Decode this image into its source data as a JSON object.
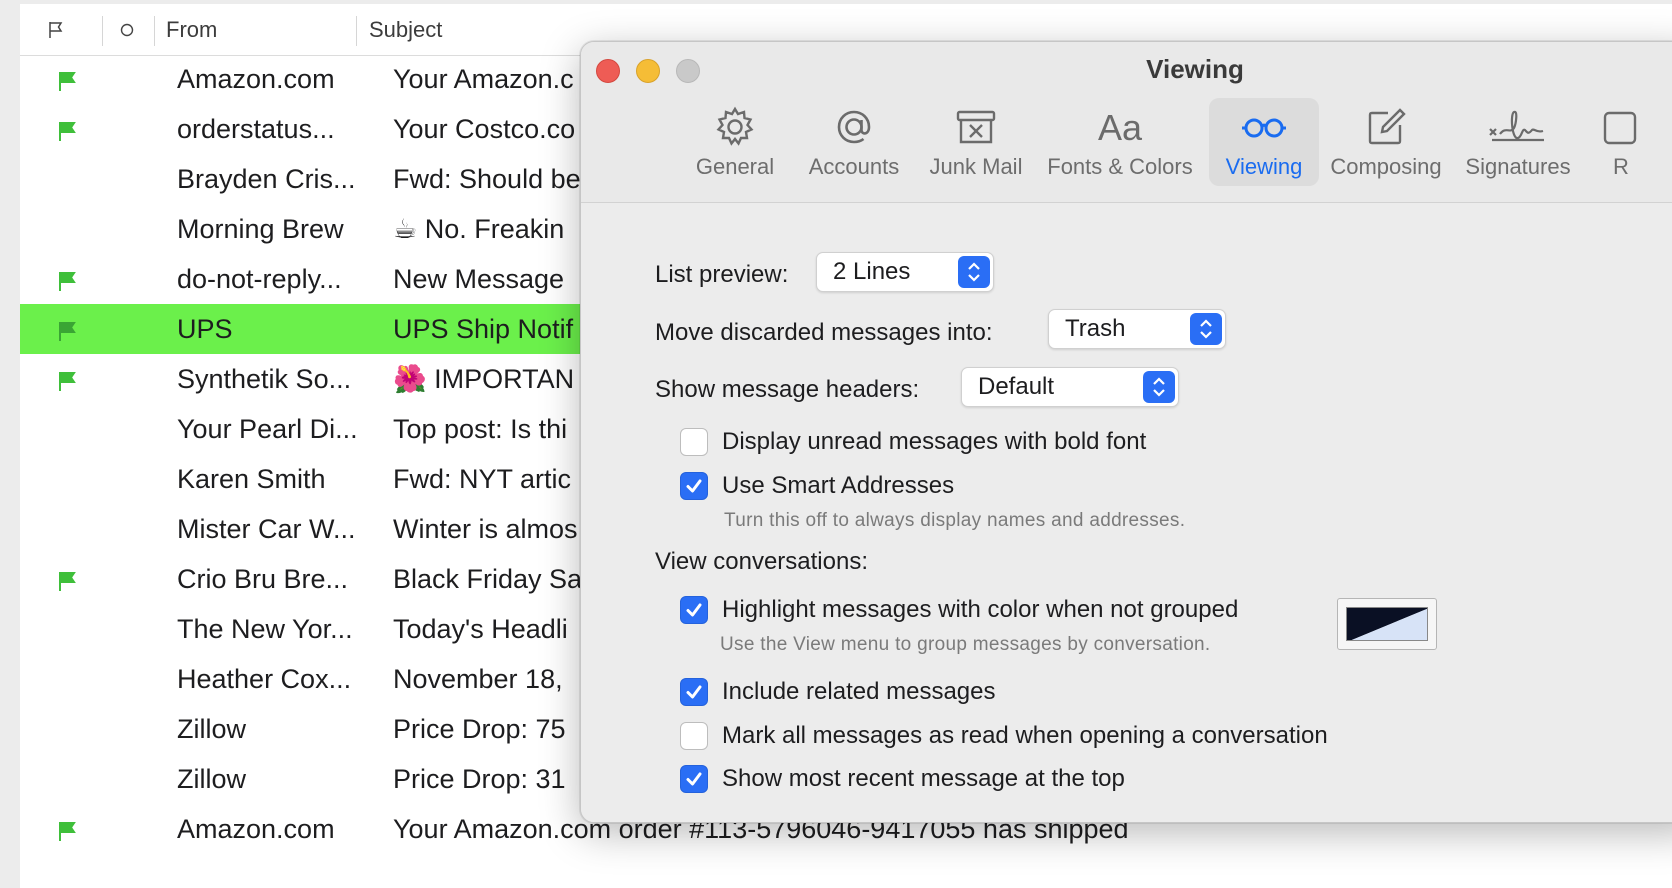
{
  "mail_list": {
    "columns": {
      "flag_icon": "flag-icon",
      "status_icon": "circle-icon",
      "from": "From",
      "subject": "Subject"
    },
    "rows": [
      {
        "from": "Amazon.com",
        "subject": "Your Amazon.c",
        "flagged": true,
        "selected": false
      },
      {
        "from": "orderstatus...",
        "subject": "Your Costco.co",
        "flagged": true,
        "selected": false
      },
      {
        "from": "Brayden Cris...",
        "subject": "Fwd: Should be",
        "flagged": false,
        "selected": false
      },
      {
        "from": "Morning Brew",
        "subject": "☕ No. Freakin",
        "flagged": false,
        "selected": false
      },
      {
        "from": "do-not-reply...",
        "subject": "New Message",
        "flagged": true,
        "selected": false
      },
      {
        "from": "UPS",
        "subject": "UPS Ship Notif",
        "flagged": true,
        "selected": true
      },
      {
        "from": "Synthetik So...",
        "subject": "🌺 IMPORTAN",
        "flagged": true,
        "selected": false
      },
      {
        "from": "Your Pearl Di...",
        "subject": "Top post: Is thi",
        "flagged": false,
        "selected": false
      },
      {
        "from": "Karen Smith",
        "subject": "Fwd: NYT artic",
        "flagged": false,
        "selected": false
      },
      {
        "from": "Mister Car W...",
        "subject": "Winter is almos",
        "flagged": false,
        "selected": false
      },
      {
        "from": "Crio Bru Bre...",
        "subject": "Black Friday Sa",
        "flagged": true,
        "selected": false
      },
      {
        "from": "The New Yor...",
        "subject": "Today's Headli",
        "flagged": false,
        "selected": false
      },
      {
        "from": "Heather Cox...",
        "subject": "November 18,",
        "flagged": false,
        "selected": false
      },
      {
        "from": "Zillow",
        "subject": "Price Drop: 75",
        "flagged": false,
        "selected": false
      },
      {
        "from": "Zillow",
        "subject": "Price Drop: 31",
        "flagged": false,
        "selected": false
      },
      {
        "from": "Amazon.com",
        "subject": "Your Amazon.com order #113-5796046-9417055 has shipped",
        "flagged": true,
        "selected": false
      }
    ],
    "flag_color": "#3fbf3a",
    "selected_color": "#6bf04b"
  },
  "prefs_window": {
    "title": "Viewing",
    "tabs": [
      {
        "label": "General",
        "icon": "gear-icon",
        "active": false
      },
      {
        "label": "Accounts",
        "icon": "at-sign-icon",
        "active": false
      },
      {
        "label": "Junk Mail",
        "icon": "junk-box-icon",
        "active": false
      },
      {
        "label": "Fonts & Colors",
        "icon": "font-aa-icon",
        "active": false
      },
      {
        "label": "Viewing",
        "icon": "glasses-icon",
        "active": true
      },
      {
        "label": "Composing",
        "icon": "compose-icon",
        "active": false
      },
      {
        "label": "Signatures",
        "icon": "signature-icon",
        "active": false
      },
      {
        "label": "R",
        "icon": "rules-icon",
        "active": false
      }
    ],
    "list_preview": {
      "label": "List preview:",
      "value": "2 Lines"
    },
    "move_discarded": {
      "label": "Move discarded messages into:",
      "value": "Trash"
    },
    "show_headers": {
      "label": "Show message headers:",
      "value": "Default"
    },
    "bold_unread": {
      "label": "Display unread messages with bold font",
      "checked": false
    },
    "smart_addresses": {
      "label": "Use Smart Addresses",
      "checked": true,
      "hint": "Turn this off to always display names and addresses."
    },
    "view_conversations": {
      "label": "View conversations:"
    },
    "highlight_color": {
      "label": "Highlight messages with color when not grouped",
      "checked": true,
      "hint": "Use the View menu to group messages by conversation.",
      "swatch_dark": "#0a1024",
      "swatch_light": "#d7e3f7"
    },
    "include_related": {
      "label": "Include related messages",
      "checked": true
    },
    "mark_all_read": {
      "label": "Mark all messages as read when opening a conversation",
      "checked": false
    },
    "recent_top": {
      "label": "Show most recent message at the top",
      "checked": true
    },
    "accent_color": "#2a6ef5"
  }
}
